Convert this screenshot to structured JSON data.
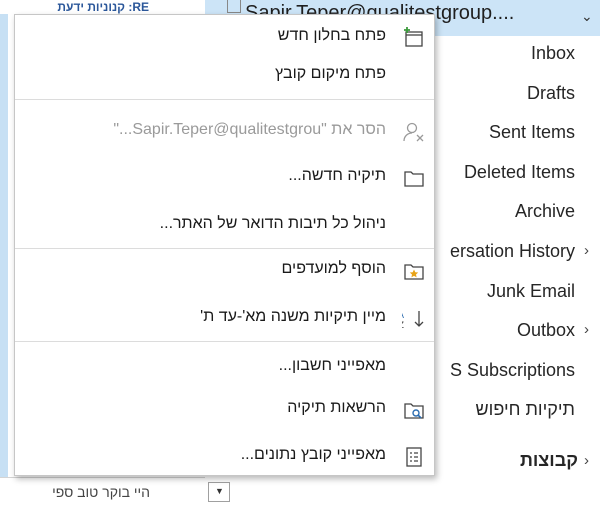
{
  "left_pane": {
    "top_text": "RE: קנוניות ידעת",
    "bottom_text": "היי בוקר טוב  ספי"
  },
  "account": {
    "name": "Sapir.Teper@qualitestgroup...."
  },
  "folders": [
    {
      "label": "Inbox",
      "chevron": false
    },
    {
      "label": "Drafts",
      "chevron": false
    },
    {
      "label": "Sent Items",
      "chevron": false
    },
    {
      "label": "Deleted Items",
      "chevron": false
    },
    {
      "label": "Archive",
      "chevron": false
    },
    {
      "label": "ersation History",
      "chevron": true
    },
    {
      "label": "Junk Email",
      "chevron": false
    },
    {
      "label": "Outbox",
      "chevron": true
    },
    {
      "label": "S Subscriptions",
      "chevron": false
    },
    {
      "label": "תיקיות חיפוש",
      "chevron": false
    }
  ],
  "groups_label": "קבוצות",
  "context_menu": {
    "items": [
      {
        "label": "פתח בחלון חדש",
        "icon": "new-window-icon",
        "enabled": true
      },
      {
        "label": "פתח מיקום קובץ",
        "icon": "",
        "enabled": true
      },
      {
        "label": "הסר את \"Sapir.Teper@qualitestgrou...\"",
        "icon": "remove-user-icon",
        "enabled": false
      },
      {
        "label": "תיקיה חדשה...",
        "icon": "new-folder-icon",
        "enabled": true
      },
      {
        "label": "ניהול כל תיבות הדואר של האתר...",
        "icon": "",
        "enabled": true
      },
      {
        "label": "הוסף למועדפים",
        "icon": "add-favorite-icon",
        "enabled": true
      },
      {
        "label": "מיין תיקיות משנה מא'-עד ת'",
        "icon": "sort-az-icon",
        "enabled": true
      },
      {
        "label": "מאפייני חשבון...",
        "icon": "",
        "enabled": true
      },
      {
        "label": "הרשאות תיקיה",
        "icon": "folder-permissions-icon",
        "enabled": true
      },
      {
        "label": "מאפייני קובץ נתונים...",
        "icon": "data-file-properties-icon",
        "enabled": true
      }
    ]
  },
  "colors": {
    "account_bg": "#cce4f7",
    "disabled_text": "#9a9a9a",
    "star": "#e8a317"
  }
}
